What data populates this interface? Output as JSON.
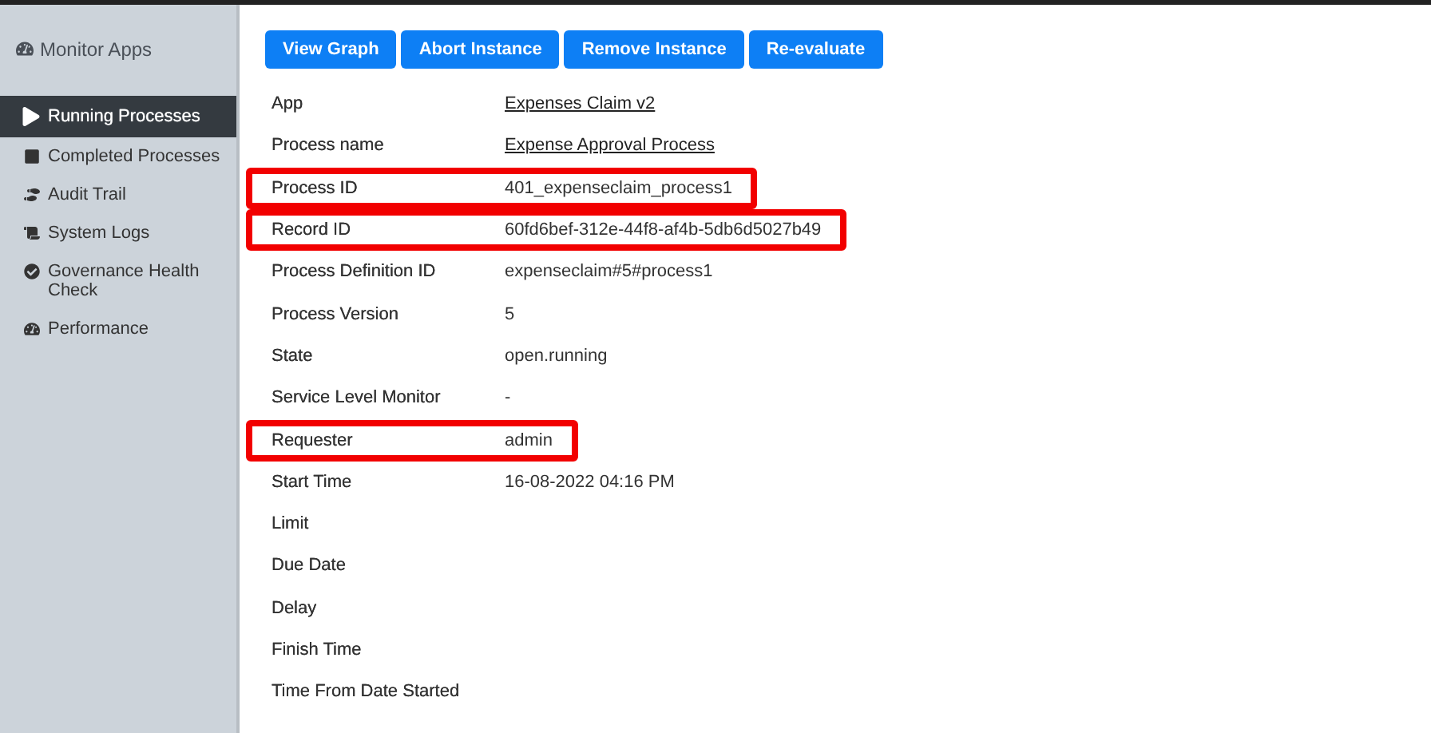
{
  "sidebar": {
    "title": "Monitor Apps",
    "items": [
      {
        "label": "Running Processes",
        "selected": true
      },
      {
        "label": "Completed Processes",
        "selected": false
      },
      {
        "label": "Audit Trail",
        "selected": false
      },
      {
        "label": "System Logs",
        "selected": false
      },
      {
        "label": "Governance Health Check",
        "selected": false
      },
      {
        "label": "Performance",
        "selected": false
      }
    ]
  },
  "buttons": [
    "View Graph",
    "Abort Instance",
    "Remove Instance",
    "Re-evaluate"
  ],
  "details": [
    {
      "label": "App",
      "value": "Expenses Claim v2",
      "link": true,
      "highlighted": false
    },
    {
      "label": "Process name",
      "value": "Expense Approval Process",
      "link": true,
      "highlighted": false
    },
    {
      "label": "Process ID",
      "value": "401_expenseclaim_process1",
      "link": false,
      "highlighted": true
    },
    {
      "label": "Record ID",
      "value": "60fd6bef-312e-44f8-af4b-5db6d5027b49",
      "link": false,
      "highlighted": true
    },
    {
      "label": "Process Definition ID",
      "value": "expenseclaim#5#process1",
      "link": false,
      "highlighted": false
    },
    {
      "label": "Process Version",
      "value": "5",
      "link": false,
      "highlighted": false
    },
    {
      "label": "State",
      "value": "open.running",
      "link": false,
      "highlighted": false
    },
    {
      "label": "Service Level Monitor",
      "value": "-",
      "link": false,
      "highlighted": false
    },
    {
      "label": "Requester",
      "value": "admin",
      "link": false,
      "highlighted": true
    },
    {
      "label": "Start Time",
      "value": "16-08-2022 04:16 PM",
      "link": false,
      "highlighted": false
    },
    {
      "label": "Limit",
      "highlighted": false
    },
    {
      "label": "Due Date",
      "highlighted": false
    },
    {
      "label": "Delay",
      "highlighted": false
    },
    {
      "label": "Finish Time",
      "highlighted": false
    },
    {
      "label": "Time From Date Started",
      "highlighted": false
    }
  ]
}
